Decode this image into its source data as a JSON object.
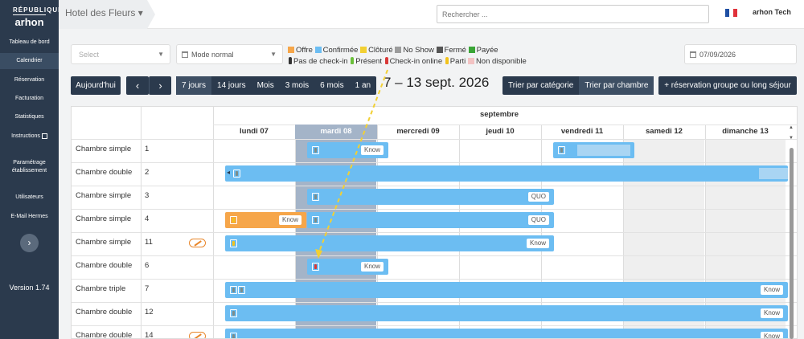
{
  "app": {
    "logo_top": "RÉPUBLIQUE",
    "logo_main": "arhon",
    "version": "Version 1.74"
  },
  "sidebar": {
    "items": [
      {
        "label": "Tableau de bord"
      },
      {
        "label": "Calendrier",
        "active": true
      },
      {
        "label": "Réservation"
      },
      {
        "label": "Facturation"
      },
      {
        "label": "Statistiques"
      },
      {
        "label": "Instructions"
      },
      {
        "label": "Paramétrage établissement"
      },
      {
        "label": "Utilisateurs"
      },
      {
        "label": "E-Mail Hermes"
      }
    ],
    "toggle_glyph": "›"
  },
  "topbar": {
    "hotel": "Hotel des Fleurs ▾",
    "search_placeholder": "Rechercher ...",
    "user": "arhon Tech",
    "flag_colors": [
      "#1f4fa3",
      "#ffffff",
      "#e0313a"
    ]
  },
  "filters": {
    "select_placeholder": "Select",
    "mode_value": "Mode normal",
    "date_value": "07/09/2026"
  },
  "legend": {
    "statuses": [
      {
        "label": "Offre",
        "color": "#f6a64a"
      },
      {
        "label": "Confirmée",
        "color": "#6cbdf2"
      },
      {
        "label": "Clôturé",
        "color": "#f2d033"
      },
      {
        "label": "No Show",
        "color": "#9c9c9c"
      },
      {
        "label": "Fermé",
        "color": "#555555"
      },
      {
        "label": "Payée",
        "color": "#3aa536"
      }
    ],
    "presence": [
      {
        "label": "Pas de check-in",
        "color": "#333333"
      },
      {
        "label": "Présent",
        "color": "#6abf3a"
      },
      {
        "label": "Check-in online",
        "color": "#d93838"
      },
      {
        "label": "Parti",
        "color": "#f2c21b"
      },
      {
        "label": "Non disponible",
        "color": "#f3c3c3",
        "swatch": true
      }
    ]
  },
  "toolbar": {
    "today": "Aujourd'hui",
    "prev": "‹",
    "next": "›",
    "ranges": [
      "7 jours",
      "14 jours",
      "Mois",
      "3 mois",
      "6 mois",
      "1 an"
    ],
    "active_range": "7 jours",
    "date_range": "7 – 13 sept. 2026",
    "sort_category": "Trier par catégorie",
    "sort_room": "Trier par chambre",
    "group_booking": "+ réservation groupe ou long séjour"
  },
  "calendar": {
    "month": "septembre",
    "days": [
      "lundi 07",
      "mardi 08",
      "mercredi 09",
      "jeudi 10",
      "vendredi 11",
      "samedi 12",
      "dimanche 13"
    ],
    "today_index": 1,
    "rooms": [
      {
        "type": "Chambre simple",
        "number": "1"
      },
      {
        "type": "Chambre double",
        "number": "2"
      },
      {
        "type": "Chambre simple",
        "number": "3"
      },
      {
        "type": "Chambre simple",
        "number": "4"
      },
      {
        "type": "Chambre simple",
        "number": "11",
        "cleaning": true
      },
      {
        "type": "Chambre double",
        "number": "6"
      },
      {
        "type": "Chambre triple",
        "number": "7"
      },
      {
        "type": "Chambre double",
        "number": "12"
      },
      {
        "type": "Chambre double",
        "number": "14",
        "cleaning": true
      }
    ],
    "tags": {
      "know": "Know",
      "quo": "QUO"
    },
    "bar_glyph": "◂"
  }
}
